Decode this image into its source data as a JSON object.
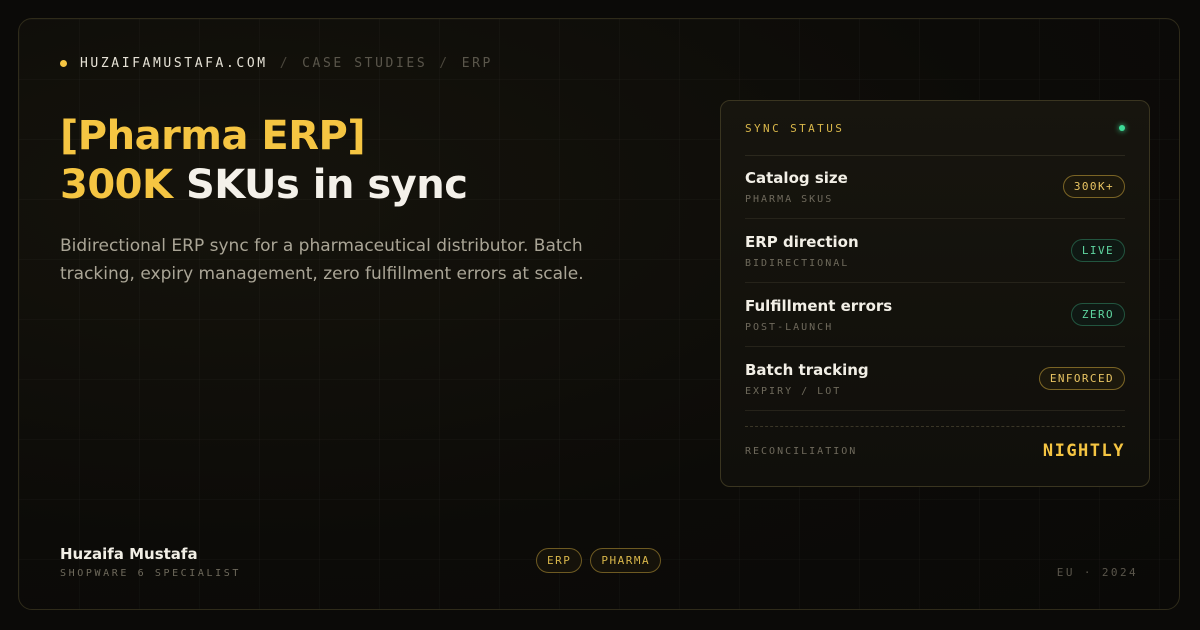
{
  "breadcrumb": {
    "site": "HUZAIFAMUSTAFA.COM",
    "separator": "/",
    "section": "CASE STUDIES",
    "page": "ERP"
  },
  "headline": {
    "line1_accent": "[Pharma ERP]",
    "line2_accent": "300K",
    "line2_rest": "SKUs in sync"
  },
  "description": "Bidirectional ERP sync for a pharmaceutical distributor. Batch tracking, expiry management, zero fulfillment errors at scale.",
  "status_card": {
    "label": "SYNC STATUS",
    "rows": [
      {
        "title": "Catalog size",
        "subtitle": "PHARMA SKUS",
        "badge": "300K+",
        "tone": "gold"
      },
      {
        "title": "ERP direction",
        "subtitle": "BIDIRECTIONAL",
        "badge": "LIVE",
        "tone": "green"
      },
      {
        "title": "Fulfillment errors",
        "subtitle": "POST-LAUNCH",
        "badge": "ZERO",
        "tone": "green"
      },
      {
        "title": "Batch tracking",
        "subtitle": "EXPIRY / LOT",
        "badge": "ENFORCED",
        "tone": "gold"
      }
    ],
    "footer_label": "RECONCILIATION",
    "footer_value": "NIGHTLY"
  },
  "author": {
    "name": "Huzaifa Mustafa",
    "role": "SHOPWARE 6 SPECIALIST"
  },
  "tags": [
    "ERP",
    "PHARMA"
  ],
  "meta": "EU · 2024",
  "colors": {
    "accent": "#f5c542",
    "status_green": "#3ddc97",
    "background": "#0b0a08"
  }
}
